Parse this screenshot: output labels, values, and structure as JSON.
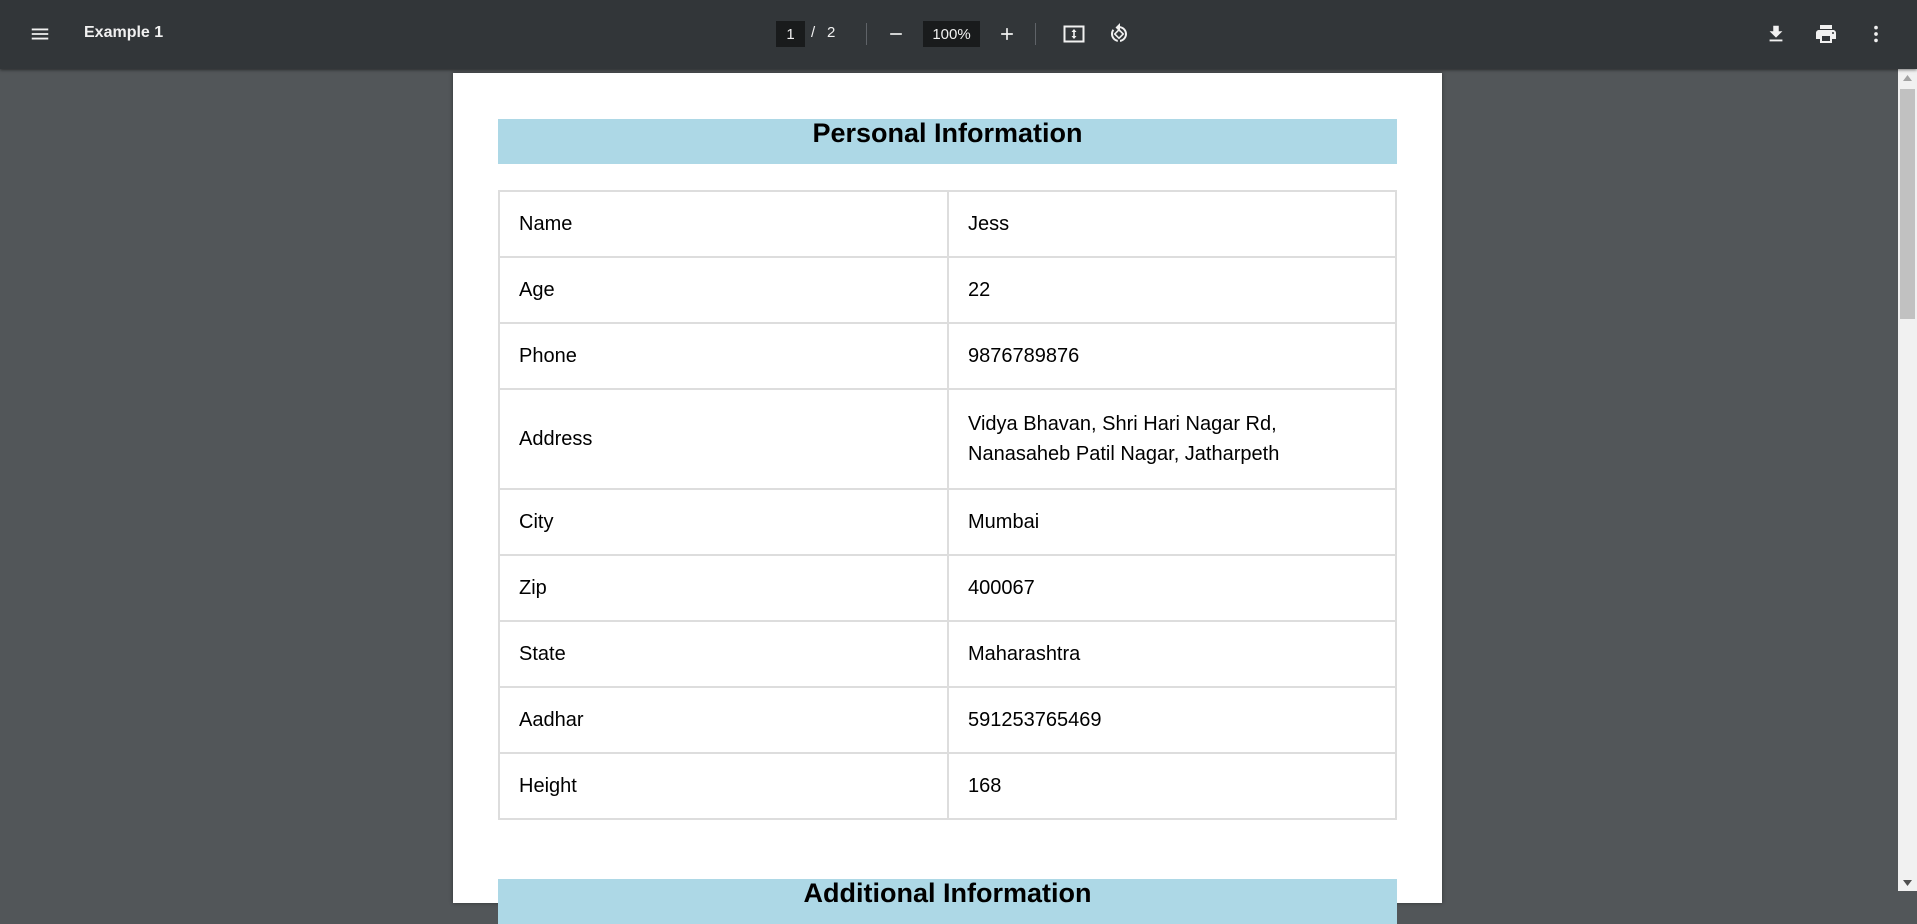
{
  "toolbar": {
    "title": "Example 1",
    "current_page": "1",
    "page_separator": "/",
    "total_pages": "2",
    "zoom": "100%",
    "icons": {
      "menu": "menu-icon",
      "zoom_out": "minus-icon",
      "zoom_in": "plus-icon",
      "fit": "fit-to-page-icon",
      "rotate": "rotate-icon",
      "download": "download-icon",
      "print": "print-icon",
      "more": "more-vert-icon"
    }
  },
  "document": {
    "section1_title": "Personal Information",
    "section2_title": "Additional Information",
    "header_color": "#add8e6",
    "rows": [
      {
        "label": "Name",
        "value": "Jess"
      },
      {
        "label": "Age",
        "value": "22"
      },
      {
        "label": "Phone",
        "value": "9876789876"
      },
      {
        "label": "Address",
        "value_line1": "Vidya Bhavan, Shri Hari Nagar Rd,",
        "value_line2": "Nanasaheb Patil Nagar, Jatharpeth"
      },
      {
        "label": "City",
        "value": "Mumbai"
      },
      {
        "label": "Zip",
        "value": "400067"
      },
      {
        "label": "State",
        "value": "Maharashtra"
      },
      {
        "label": "Aadhar",
        "value": "591253765469"
      },
      {
        "label": "Height",
        "value": "168"
      }
    ]
  },
  "colors": {
    "toolbar_bg": "#323639",
    "viewer_bg": "#525659"
  }
}
